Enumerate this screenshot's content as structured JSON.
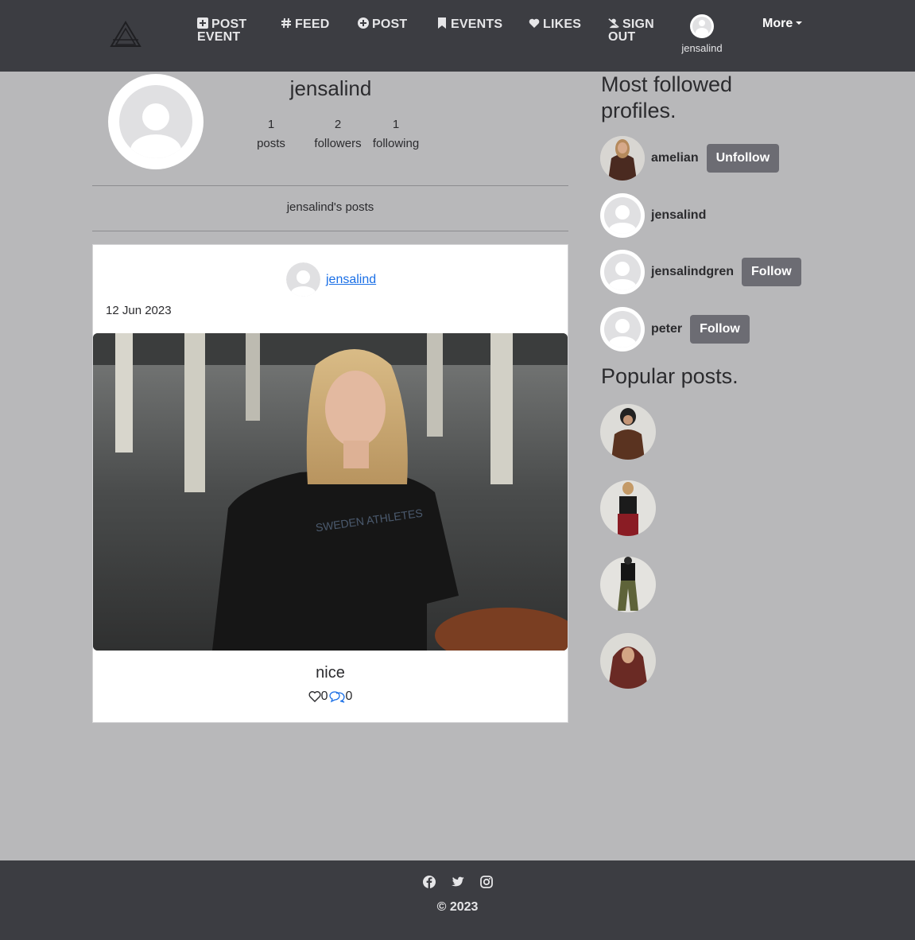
{
  "navbar": {
    "logo": "triangle-logo",
    "items": [
      {
        "label": "POST EVENT",
        "icon": "plus-square-icon"
      },
      {
        "label": "FEED",
        "icon": "hash-icon"
      },
      {
        "label": "POST",
        "icon": "plus-circle-icon"
      },
      {
        "label": "EVENTS",
        "icon": "bookmark-icon"
      },
      {
        "label": "LIKES",
        "icon": "heart-icon"
      },
      {
        "label": "SIGN OUT",
        "icon": "user-slash-icon"
      }
    ],
    "profile_name": "jensalind",
    "more_label": "More"
  },
  "profile": {
    "username": "jensalind",
    "stats": {
      "posts_count": "1",
      "posts_label": "posts",
      "followers_count": "2",
      "followers_label": "followers",
      "following_count": "1",
      "following_label": "following"
    },
    "posts_heading": "jensalind's posts"
  },
  "post": {
    "author": "jensalind",
    "date": "12 Jun 2023",
    "image_text": "SWEDEN ATHLETES",
    "title": "nice",
    "likes": "0",
    "comments": "0"
  },
  "sidebar": {
    "followed_heading_line1": "Most followed",
    "followed_heading_line2": "profiles.",
    "profiles": [
      {
        "name": "amelian",
        "button": "Unfollow"
      },
      {
        "name": "jensalind",
        "button": ""
      },
      {
        "name": "jensalindgren",
        "button": "Follow"
      },
      {
        "name": "peter",
        "button": "Follow"
      }
    ],
    "popular_heading": "Popular posts."
  },
  "footer": {
    "social": [
      "facebook-icon",
      "twitter-icon",
      "instagram-icon"
    ],
    "copyright": "© 2023"
  },
  "colors": {
    "navbar_bg": "#3c3d42",
    "page_bg": "#b8b8ba",
    "button_bg": "#6c6c73",
    "link": "#1a6fe6"
  }
}
